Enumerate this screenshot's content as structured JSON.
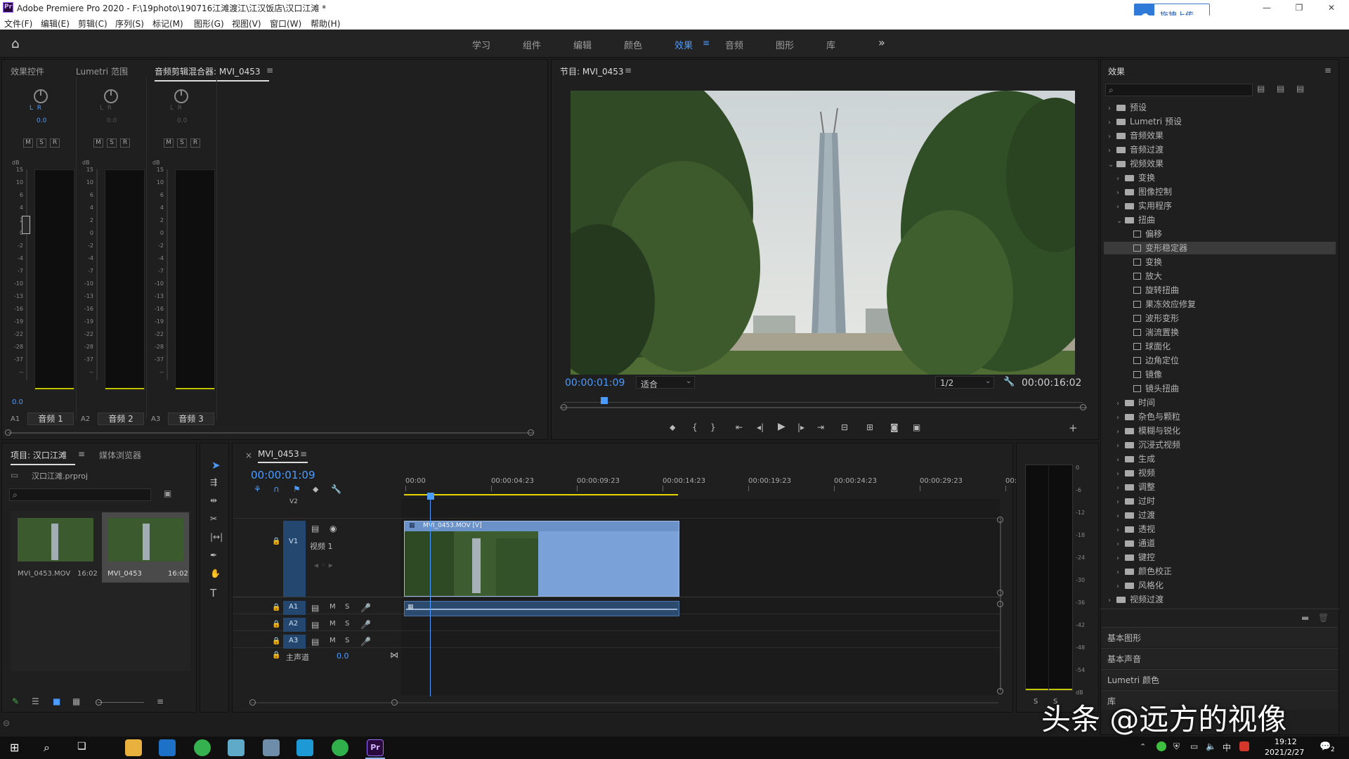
{
  "app": {
    "title": "Adobe Premiere Pro 2020 - F:\\19photo\\190716江滩渡江\\江汉饭店\\汉口江滩 *",
    "upload_label": "拖拽上传"
  },
  "menu": [
    "文件(F)",
    "编辑(E)",
    "剪辑(C)",
    "序列(S)",
    "标记(M)",
    "图形(G)",
    "视图(V)",
    "窗口(W)",
    "帮助(H)"
  ],
  "workspaces": [
    "学习",
    "组件",
    "编辑",
    "颜色",
    "效果",
    "音频",
    "图形",
    "库"
  ],
  "active_workspace": "效果",
  "left_panel": {
    "tabs": [
      "效果控件",
      "Lumetri 范围",
      "音频剪辑混合器: MVI_0453"
    ],
    "channels": [
      {
        "lr": "L  R",
        "val": "0.0",
        "id": "A1",
        "name": "音频 1"
      },
      {
        "lr": "L  R",
        "val": "0.0",
        "id": "A2",
        "name": "音频 2"
      },
      {
        "lr": "L  R",
        "val": "0.0",
        "id": "A3",
        "name": "音频 3"
      }
    ],
    "db_label": "dB",
    "db_scale": [
      "15",
      "10",
      "6",
      "4",
      "2",
      "0",
      "-2",
      "-4",
      "-7",
      "-10",
      "-13",
      "-16",
      "-19",
      "-22",
      "-28",
      "-37",
      "--"
    ],
    "m": "M",
    "s": "S",
    "r": "R",
    "bottom_value": "0.0"
  },
  "program": {
    "title": "节目: MVI_0453",
    "timecode": "00:00:01:09",
    "fit": "适合",
    "resolution": "1/2",
    "duration": "00:00:16:02"
  },
  "effects": {
    "title": "效果",
    "items": [
      {
        "label": "预设",
        "level": 0,
        "type": "folder",
        "chev": "›"
      },
      {
        "label": "Lumetri 预设",
        "level": 0,
        "type": "folder",
        "chev": "›"
      },
      {
        "label": "音频效果",
        "level": 0,
        "type": "folder",
        "chev": "›"
      },
      {
        "label": "音频过渡",
        "level": 0,
        "type": "folder",
        "chev": "›"
      },
      {
        "label": "视频效果",
        "level": 0,
        "type": "folder",
        "chev": "⌄"
      },
      {
        "label": "变换",
        "level": 1,
        "type": "folder",
        "chev": "›"
      },
      {
        "label": "图像控制",
        "level": 1,
        "type": "folder",
        "chev": "›"
      },
      {
        "label": "实用程序",
        "level": 1,
        "type": "folder",
        "chev": "›"
      },
      {
        "label": "扭曲",
        "level": 1,
        "type": "folder",
        "chev": "⌄"
      },
      {
        "label": "偏移",
        "level": 2,
        "type": "fx",
        "chev": ""
      },
      {
        "label": "变形稳定器",
        "level": 2,
        "type": "fx",
        "chev": "",
        "selected": true
      },
      {
        "label": "变换",
        "level": 2,
        "type": "fx",
        "chev": ""
      },
      {
        "label": "放大",
        "level": 2,
        "type": "fx",
        "chev": ""
      },
      {
        "label": "旋转扭曲",
        "level": 2,
        "type": "fx",
        "chev": ""
      },
      {
        "label": "果冻效应修复",
        "level": 2,
        "type": "fx",
        "chev": ""
      },
      {
        "label": "波形变形",
        "level": 2,
        "type": "fx",
        "chev": ""
      },
      {
        "label": "湍流置换",
        "level": 2,
        "type": "fx",
        "chev": ""
      },
      {
        "label": "球面化",
        "level": 2,
        "type": "fx",
        "chev": ""
      },
      {
        "label": "边角定位",
        "level": 2,
        "type": "fx",
        "chev": ""
      },
      {
        "label": "镜像",
        "level": 2,
        "type": "fx",
        "chev": ""
      },
      {
        "label": "镜头扭曲",
        "level": 2,
        "type": "fx",
        "chev": ""
      },
      {
        "label": "时间",
        "level": 1,
        "type": "folder",
        "chev": "›"
      },
      {
        "label": "杂色与颗粒",
        "level": 1,
        "type": "folder",
        "chev": "›"
      },
      {
        "label": "模糊与锐化",
        "level": 1,
        "type": "folder",
        "chev": "›"
      },
      {
        "label": "沉浸式视频",
        "level": 1,
        "type": "folder",
        "chev": "›"
      },
      {
        "label": "生成",
        "level": 1,
        "type": "folder",
        "chev": "›"
      },
      {
        "label": "视频",
        "level": 1,
        "type": "folder",
        "chev": "›"
      },
      {
        "label": "调整",
        "level": 1,
        "type": "folder",
        "chev": "›"
      },
      {
        "label": "过时",
        "level": 1,
        "type": "folder",
        "chev": "›"
      },
      {
        "label": "过渡",
        "level": 1,
        "type": "folder",
        "chev": "›"
      },
      {
        "label": "透视",
        "level": 1,
        "type": "folder",
        "chev": "›"
      },
      {
        "label": "通道",
        "level": 1,
        "type": "folder",
        "chev": "›"
      },
      {
        "label": "键控",
        "level": 1,
        "type": "folder",
        "chev": "›"
      },
      {
        "label": "颜色校正",
        "level": 1,
        "type": "folder",
        "chev": "›"
      },
      {
        "label": "风格化",
        "level": 1,
        "type": "folder",
        "chev": "›"
      },
      {
        "label": "视频过渡",
        "level": 0,
        "type": "folder",
        "chev": "›"
      }
    ],
    "sections": [
      "基本图形",
      "基本声音",
      "Lumetri 颜色",
      "库"
    ]
  },
  "project": {
    "tabs": [
      "项目: 汉口江滩",
      "媒体浏览器"
    ],
    "file": "汉口江滩.prproj",
    "clips": [
      {
        "name": "MVI_0453.MOV",
        "dur": "16:02"
      },
      {
        "name": "MVI_0453",
        "dur": "16:02"
      }
    ]
  },
  "timeline": {
    "tab": "MVI_0453",
    "timecode": "00:00:01:09",
    "ruler": [
      "00:00",
      "00:00:04:23",
      "00:00:09:23",
      "00:00:14:23",
      "00:00:19:23",
      "00:00:24:23",
      "00:00:29:23",
      "00:0"
    ],
    "tracks_video": [
      {
        "id": "V2",
        "name": ""
      },
      {
        "id": "V1",
        "name": "视频 1"
      }
    ],
    "tracks_audio": [
      "A1",
      "A2",
      "A3"
    ],
    "master": "主声道",
    "master_val": "0.0",
    "clip_label": "MVI_0453.MOV [V]",
    "m": "M",
    "s": "S"
  },
  "meter_scale": [
    "0",
    "-6",
    "-12",
    "-18",
    "-24",
    "-30",
    "-36",
    "-42",
    "-48",
    "-54",
    "dB"
  ],
  "meter_s": "S",
  "watermark": "头条 @远方的视像",
  "taskbar": {
    "time": "19:12",
    "date": "2021/2/27",
    "ime": "中",
    "badge": "2"
  }
}
